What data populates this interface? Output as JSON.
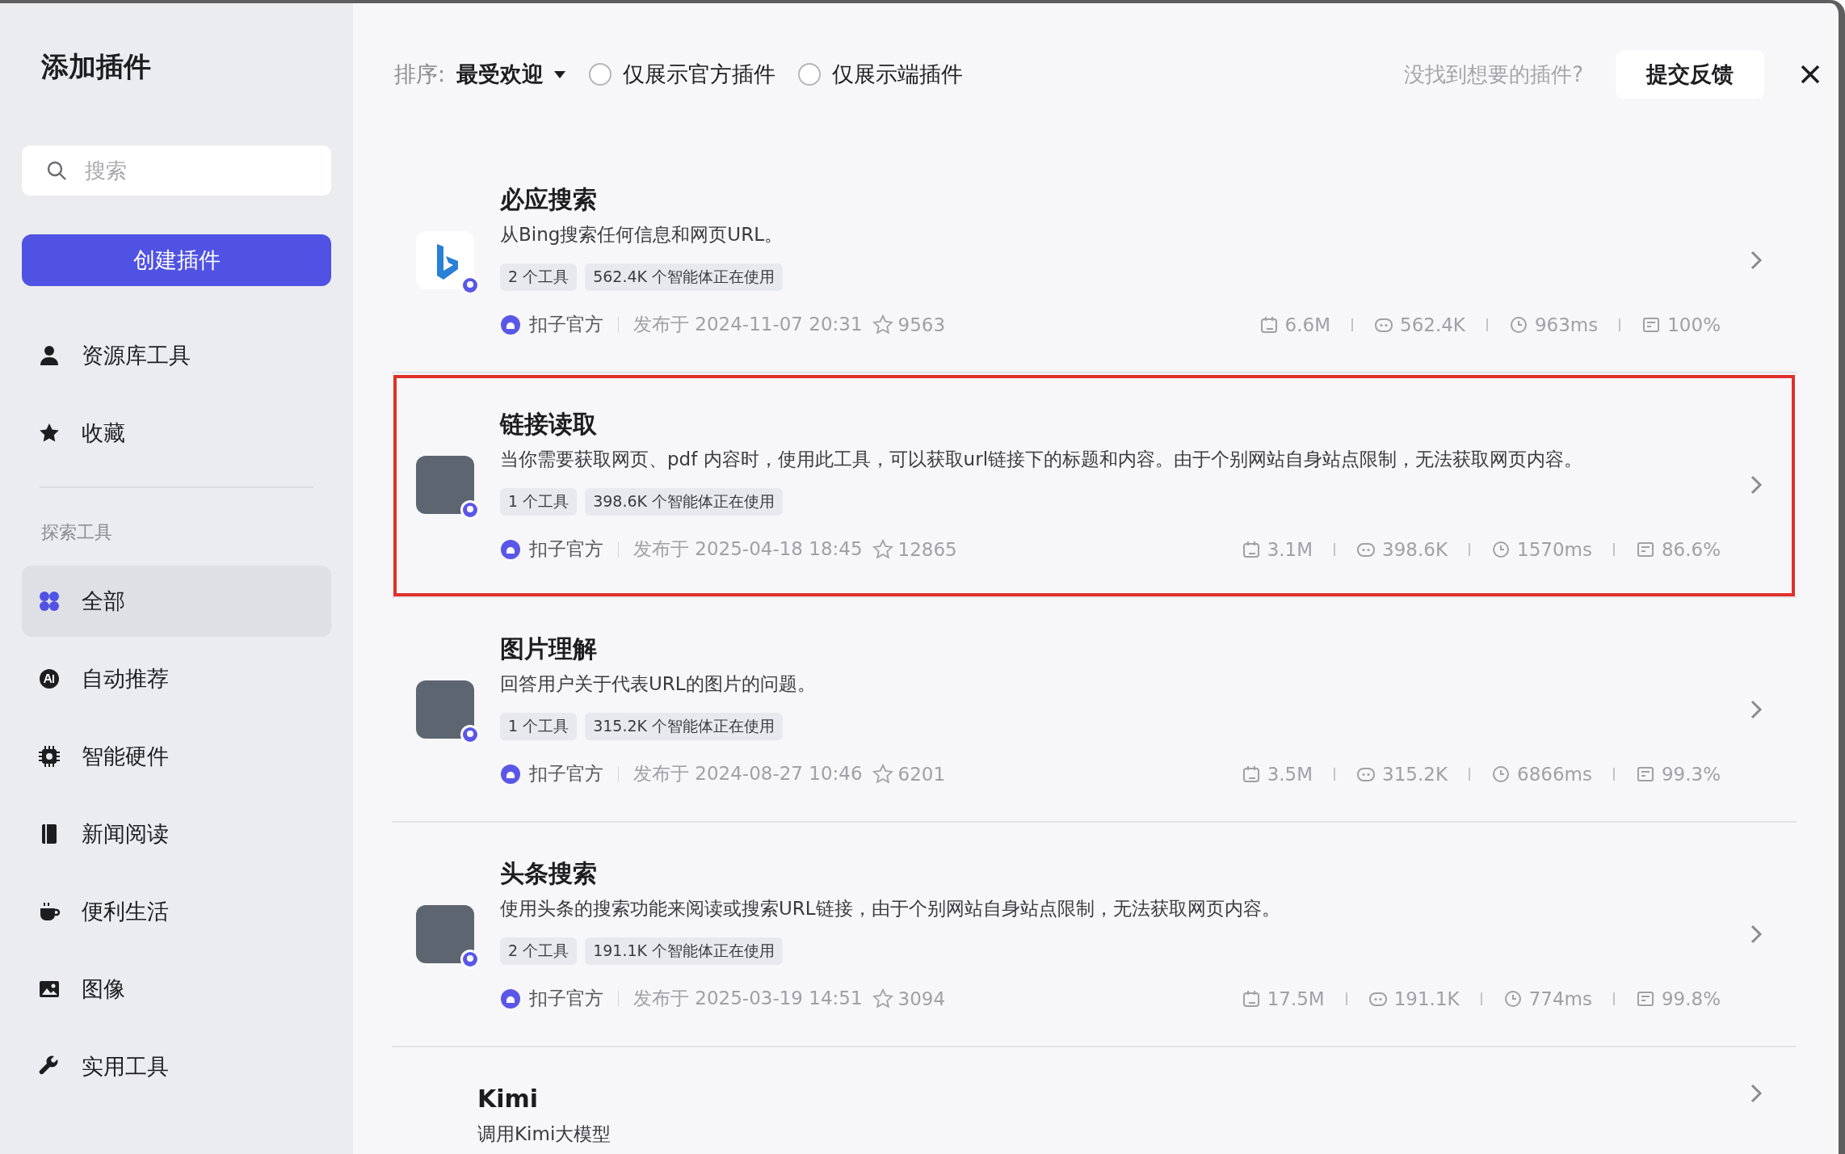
{
  "sidebar": {
    "title": "添加插件",
    "search": {
      "placeholder": "搜索"
    },
    "create_button": "创建插件",
    "top_items": [
      {
        "label": "资源库工具",
        "selected": false
      },
      {
        "label": "收藏",
        "selected": false
      }
    ],
    "section_title": "探索工具",
    "items": [
      {
        "label": "全部",
        "selected": true
      },
      {
        "label": "自动推荐",
        "selected": false
      },
      {
        "label": "智能硬件",
        "selected": false
      },
      {
        "label": "新闻阅读",
        "selected": false
      },
      {
        "label": "便利生活",
        "selected": false
      },
      {
        "label": "图像",
        "selected": false
      },
      {
        "label": "实用工具",
        "selected": false
      }
    ]
  },
  "toolbar": {
    "sort_label": "排序:",
    "sort_value": "最受欢迎",
    "filters": [
      {
        "label": "仅展示官方插件",
        "checked": false
      },
      {
        "label": "仅展示端插件",
        "checked": false
      }
    ],
    "hint": "没找到想要的插件?",
    "feedback_button": "提交反馈"
  },
  "plugins": [
    {
      "title": "必应搜索",
      "description": "从Bing搜索任何信息和网页URL。",
      "kind": "logo",
      "highlighted": false,
      "tags": [
        "2 个工具",
        "562.4K 个智能体正在使用"
      ],
      "publisher": "扣子官方",
      "published": "发布于 2024-11-07 20:31",
      "favorites": "9563",
      "stats": [
        "6.6M",
        "562.4K",
        "963ms",
        "100%"
      ]
    },
    {
      "title": "链接读取",
      "description": "当你需要获取网页、pdf 内容时，使用此工具，可以获取url链接下的标题和内容。由于个别网站自身站点限制，无法获取网页内容。",
      "kind": "photo",
      "highlighted": true,
      "tags": [
        "1 个工具",
        "398.6K 个智能体正在使用"
      ],
      "publisher": "扣子官方",
      "published": "发布于 2025-04-18 18:45",
      "favorites": "12865",
      "stats": [
        "3.1M",
        "398.6K",
        "1570ms",
        "86.6%"
      ]
    },
    {
      "title": "图片理解",
      "description": "回答用户关于代表URL的图片的问题。",
      "kind": "photo",
      "highlighted": false,
      "tags": [
        "1 个工具",
        "315.2K 个智能体正在使用"
      ],
      "publisher": "扣子官方",
      "published": "发布于 2024-08-27 10:46",
      "favorites": "6201",
      "stats": [
        "3.5M",
        "315.2K",
        "6866ms",
        "99.3%"
      ]
    },
    {
      "title": "头条搜索",
      "description": "使用头条的搜索功能来阅读或搜索URL链接，由于个别网站自身站点限制，无法获取网页内容。",
      "kind": "photo",
      "highlighted": false,
      "tags": [
        "2 个工具",
        "191.1K 个智能体正在使用"
      ],
      "publisher": "扣子官方",
      "published": "发布于 2025-03-19 14:51",
      "favorites": "3094",
      "stats": [
        "17.5M",
        "191.1K",
        "774ms",
        "99.8%"
      ]
    },
    {
      "title": "Kimi",
      "description": "调用Kimi大模型",
      "kind": "text",
      "highlighted": false
    }
  ]
}
